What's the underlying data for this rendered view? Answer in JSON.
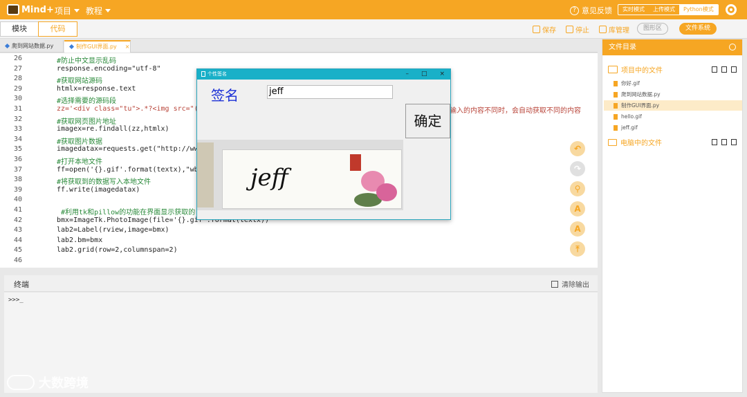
{
  "topbar": {
    "logo": "Mind+",
    "menus": [
      "项目",
      "教程"
    ],
    "feedback": "意见反馈",
    "modes": [
      "实时模式",
      "上传模式",
      "Python模式"
    ],
    "selected_mode": "Python模式"
  },
  "toolbar2": {
    "tabs": [
      "模块",
      "代码"
    ],
    "active_tab": "代码",
    "actions": [
      "保存",
      "停止",
      "库管理",
      "图形区",
      "文件系统"
    ]
  },
  "file_tabs": [
    {
      "label": "爬到网站数据.py",
      "active": false
    },
    {
      "label": "制作GUI界面.py",
      "active": true,
      "close": "×"
    }
  ],
  "code_lines": [
    {
      "n": "26",
      "text": "#防止中文显示乱码",
      "kind": "cmt"
    },
    {
      "n": "27",
      "text": "response.encoding=\"utf-8\"",
      "kind": "code"
    },
    {
      "n": "28",
      "text": "#获取网站源码",
      "kind": "cmt"
    },
    {
      "n": "29",
      "text": "htmlx=response.text",
      "kind": "code"
    },
    {
      "n": "30",
      "text": "#选择需要的源码段",
      "kind": "cmt"
    },
    {
      "n": "31",
      "text": "zz='<div class=\"tu\">.*?<img src=\"(.",
      "kind": "str"
    },
    {
      "n": "32",
      "text": "#获取网页图片地址",
      "kind": "cmt"
    },
    {
      "n": "33",
      "text": "imagex=re.findall(zz,htmlx)",
      "kind": "code"
    },
    {
      "n": "34",
      "text": "#获取图片数据",
      "kind": "cmt"
    },
    {
      "n": "35",
      "text": "imagedatax=requests.get(\"http://www",
      "kind": "code"
    },
    {
      "n": "36",
      "text": "#打开本地文件",
      "kind": "cmt"
    },
    {
      "n": "37",
      "text": "ff=open('{}.gif'.format(textx),\"wb\"",
      "kind": "code"
    },
    {
      "n": "38",
      "text": "#将获取到的数据写入本地文件",
      "kind": "cmt"
    },
    {
      "n": "39",
      "text": "ff.write(imagedatax)",
      "kind": "code"
    },
    {
      "n": "40",
      "text": "",
      "kind": "code"
    },
    {
      "n": "41",
      "text": " #利用tk和pillow的功能在界面显示获取的",
      "kind": "cmt"
    },
    {
      "n": "42",
      "text": "bmx=ImageTk.PhotoImage(file='{}.gif'.format(textx))",
      "kind": "code"
    },
    {
      "n": "43",
      "text": "lab2=Label(rview,image=bmx)",
      "kind": "code"
    },
    {
      "n": "44",
      "text": "lab2.bm=bmx",
      "kind": "code"
    },
    {
      "n": "45",
      "text": "lab2.grid(row=2,columnspan=2)",
      "kind": "code"
    },
    {
      "n": "46",
      "text": "",
      "kind": "code"
    }
  ],
  "code_overflow_comment": "输入的内容不同时，会自动获取不同的内容",
  "terminal": {
    "title": "终端",
    "clear": "清除输出",
    "prompt": ">>>_"
  },
  "right_panel": {
    "title": "文件目录",
    "project_section": "项目中的文件",
    "files": [
      "你好.gif",
      "爬到网站数据.py",
      "制作GUI界面.py",
      "hello.gif",
      "jeff.gif"
    ],
    "active_file": "制作GUI界面.py",
    "computer_section": "电脑中的文件"
  },
  "popup": {
    "title": "个性签名",
    "label": "签名",
    "input_value": "jeff",
    "button": "确定",
    "signature_text": "jeff",
    "controls": [
      "–",
      "□",
      "×"
    ]
  },
  "watermark": "大数跨境",
  "colors": {
    "accent": "#f6a623",
    "popup_title": "#19b0c8",
    "label_blue": "#1a2fd6"
  }
}
